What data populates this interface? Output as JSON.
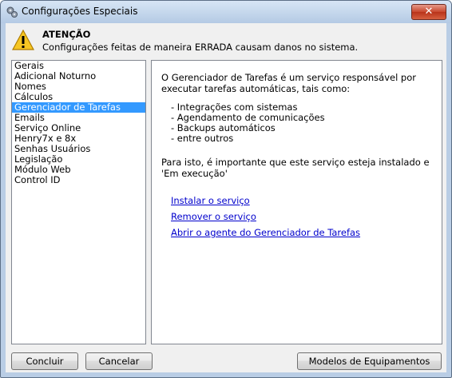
{
  "window": {
    "title": "Configurações Especiais",
    "close_label": "✕"
  },
  "warning": {
    "title": "ATENÇÃO",
    "text": "Configurações feitas de maneira ERRADA causam danos no sistema."
  },
  "sidebar": {
    "selected_index": 4,
    "items": [
      {
        "label": "Gerais"
      },
      {
        "label": "Adicional Noturno"
      },
      {
        "label": "Nomes"
      },
      {
        "label": "Cálculos"
      },
      {
        "label": "Gerenciador de Tarefas"
      },
      {
        "label": "Emails"
      },
      {
        "label": "Serviço Online"
      },
      {
        "label": "Henry7x e 8x"
      },
      {
        "label": "Senhas Usuários"
      },
      {
        "label": "Legislação"
      },
      {
        "label": "Módulo Web"
      },
      {
        "label": "Control ID"
      }
    ]
  },
  "content": {
    "intro_line1": "O Gerenciador de Tarefas é um serviço responsável por",
    "intro_line2": "executar tarefas automáticas, tais como:",
    "bullets": [
      "- Integrações com sistemas",
      "- Agendamento de comunicações",
      "- Backups automáticos",
      "- entre outros"
    ],
    "note_line1": "Para isto, é importante que este serviço esteja instalado e",
    "note_line2": "'Em execução'",
    "links": {
      "install": "Instalar o serviço",
      "remove": "Remover o serviço",
      "open_agent": "Abrir o agente do Gerenciador de Tarefas"
    }
  },
  "buttons": {
    "conclude": "Concluir",
    "cancel": "Cancelar",
    "models": "Modelos de Equipamentos"
  }
}
